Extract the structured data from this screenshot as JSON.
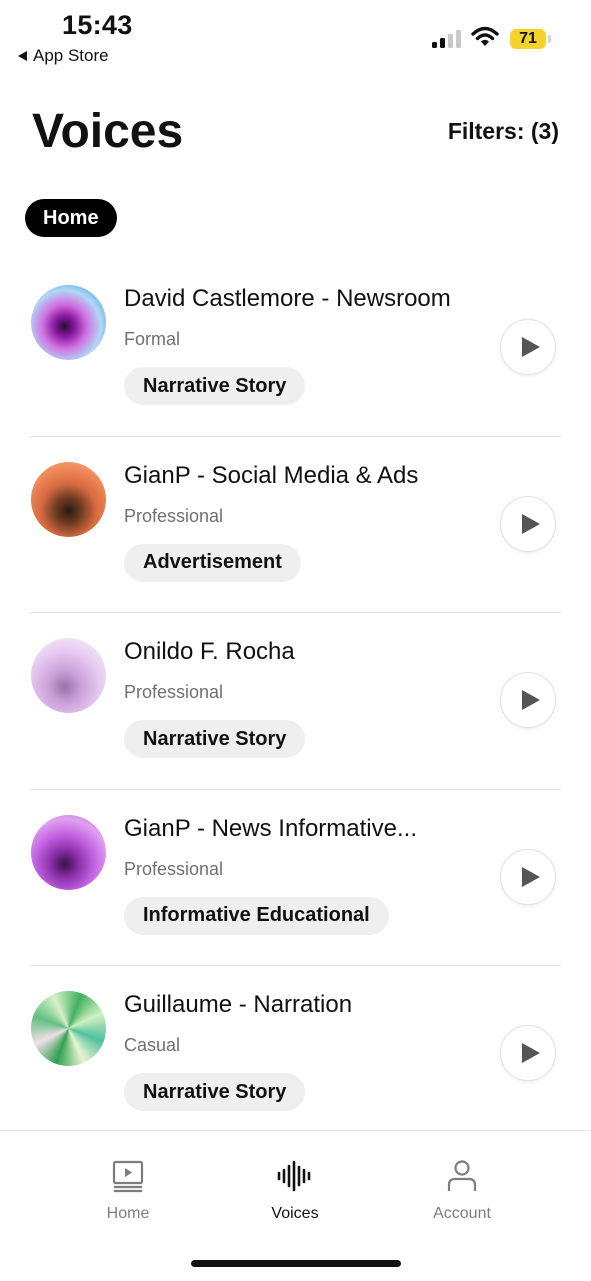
{
  "status": {
    "time": "15:43",
    "back_label": "App Store",
    "battery": "71"
  },
  "header": {
    "title": "Voices",
    "filters_label": "Filters: (3)"
  },
  "filter_chip": {
    "label": "Home"
  },
  "voices": [
    {
      "name": "David Castlemore - Newsroom",
      "style": "Formal",
      "tag": "Narrative Story"
    },
    {
      "name": "GianP - Social Media & Ads",
      "style": "Professional",
      "tag": "Advertisement"
    },
    {
      "name": "Onildo F. Rocha",
      "style": "Professional",
      "tag": "Narrative Story"
    },
    {
      "name": "GianP - News Informative...",
      "style": "Professional",
      "tag": "Informative Educational"
    },
    {
      "name": "Guillaume - Narration",
      "style": "Casual",
      "tag": "Narrative Story"
    }
  ],
  "tabbar": [
    {
      "label": "Home",
      "icon": "play-screen-icon",
      "active": false
    },
    {
      "label": "Voices",
      "icon": "waveform-icon",
      "active": true
    },
    {
      "label": "Account",
      "icon": "person-icon",
      "active": false
    }
  ],
  "colors": {
    "battery": "#f5d42a",
    "chip_active": "#000000",
    "tag_bg": "#efefef"
  }
}
